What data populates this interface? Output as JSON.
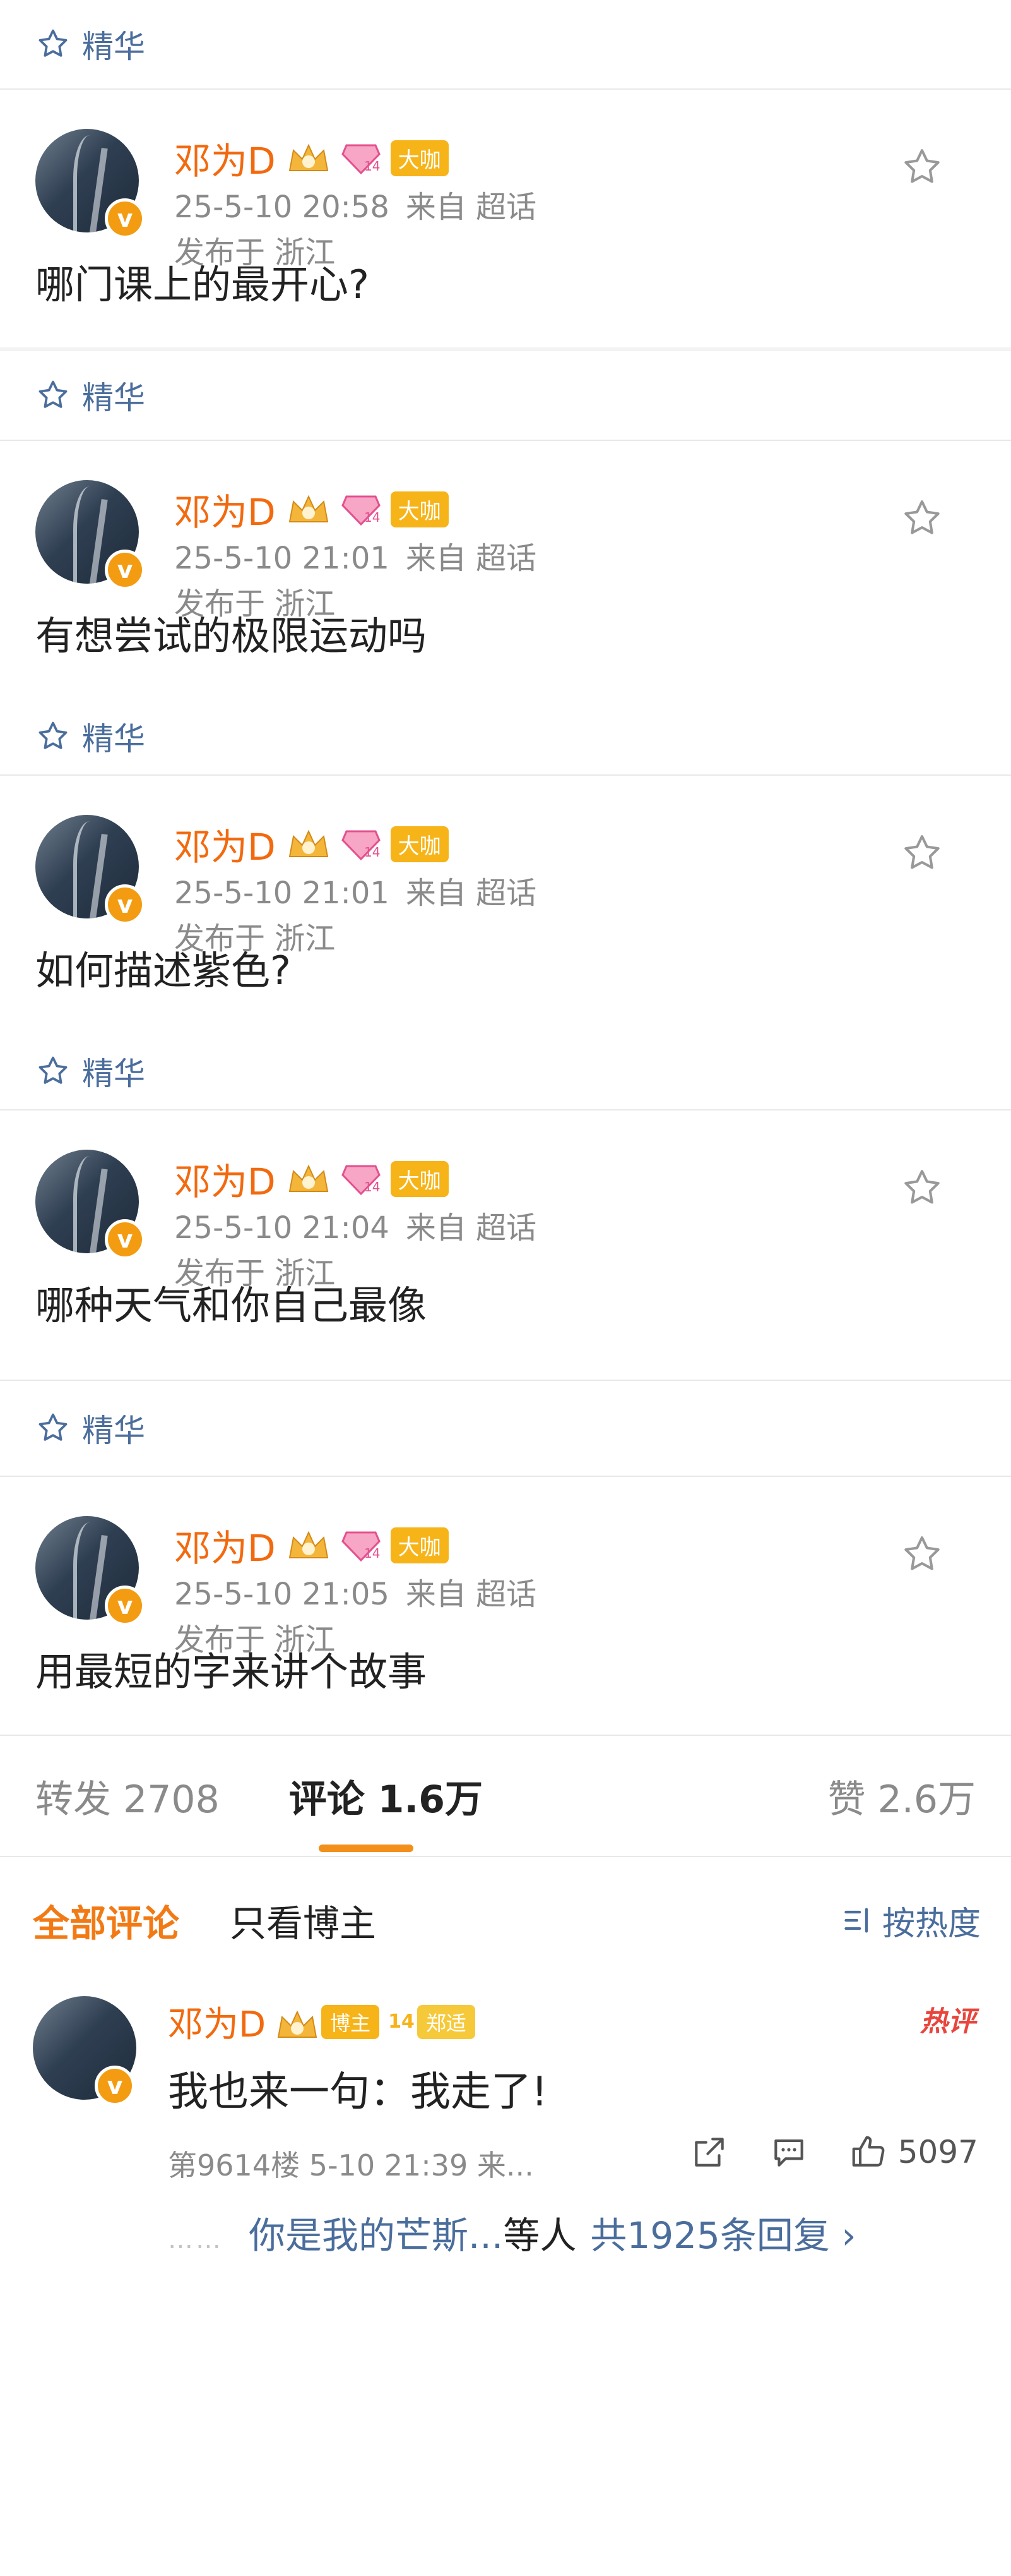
{
  "essence_label": "精华",
  "posts": [
    {
      "author": "邓为D",
      "badge": "大咖",
      "vip_level": "14",
      "time": "25-5-10 20:58",
      "source": "来自 超话",
      "location": "发布于 浙江",
      "text": "哪门课上的最开心?"
    },
    {
      "author": "邓为D",
      "badge": "大咖",
      "vip_level": "14",
      "time": "25-5-10 21:01",
      "source": "来自 超话",
      "location": "发布于 浙江",
      "text": "有想尝试的极限运动吗"
    },
    {
      "author": "邓为D",
      "badge": "大咖",
      "vip_level": "14",
      "time": "25-5-10 21:01",
      "source": "来自 超话",
      "location": "发布于 浙江",
      "text": "如何描述紫色?"
    },
    {
      "author": "邓为D",
      "badge": "大咖",
      "vip_level": "14",
      "time": "25-5-10 21:04",
      "source": "来自 超话",
      "location": "发布于 浙江",
      "text": "哪种天气和你自己最像"
    },
    {
      "author": "邓为D",
      "badge": "大咖",
      "vip_level": "14",
      "time": "25-5-10 21:05",
      "source": "来自 超话",
      "location": "发布于 浙江",
      "text": "用最短的字来讲个故事"
    }
  ],
  "stats": {
    "repost": "转发 2708",
    "comment": "评论 1.6万",
    "like": "赞 2.6万"
  },
  "filter": {
    "all": "全部评论",
    "blogger_only": "只看博主",
    "sort": "按热度"
  },
  "comment": {
    "author": "邓为D",
    "blogger_tag": "博主",
    "topic_level": "14",
    "topic_tag": "郑适",
    "hot_label": "热评",
    "text": "我也来一句：我走了!",
    "meta": "第9614楼 5-10 21:39 来...",
    "like_count": "5097",
    "reply_dots": "……",
    "reply_names": "你是我的芒斯...",
    "reply_others": "等人",
    "reply_total": "共1925条回复 ›"
  },
  "colors": {
    "accent_orange": "#f26a0f",
    "link_blue": "#4a6d9c",
    "vip_gold": "#f6b419"
  }
}
